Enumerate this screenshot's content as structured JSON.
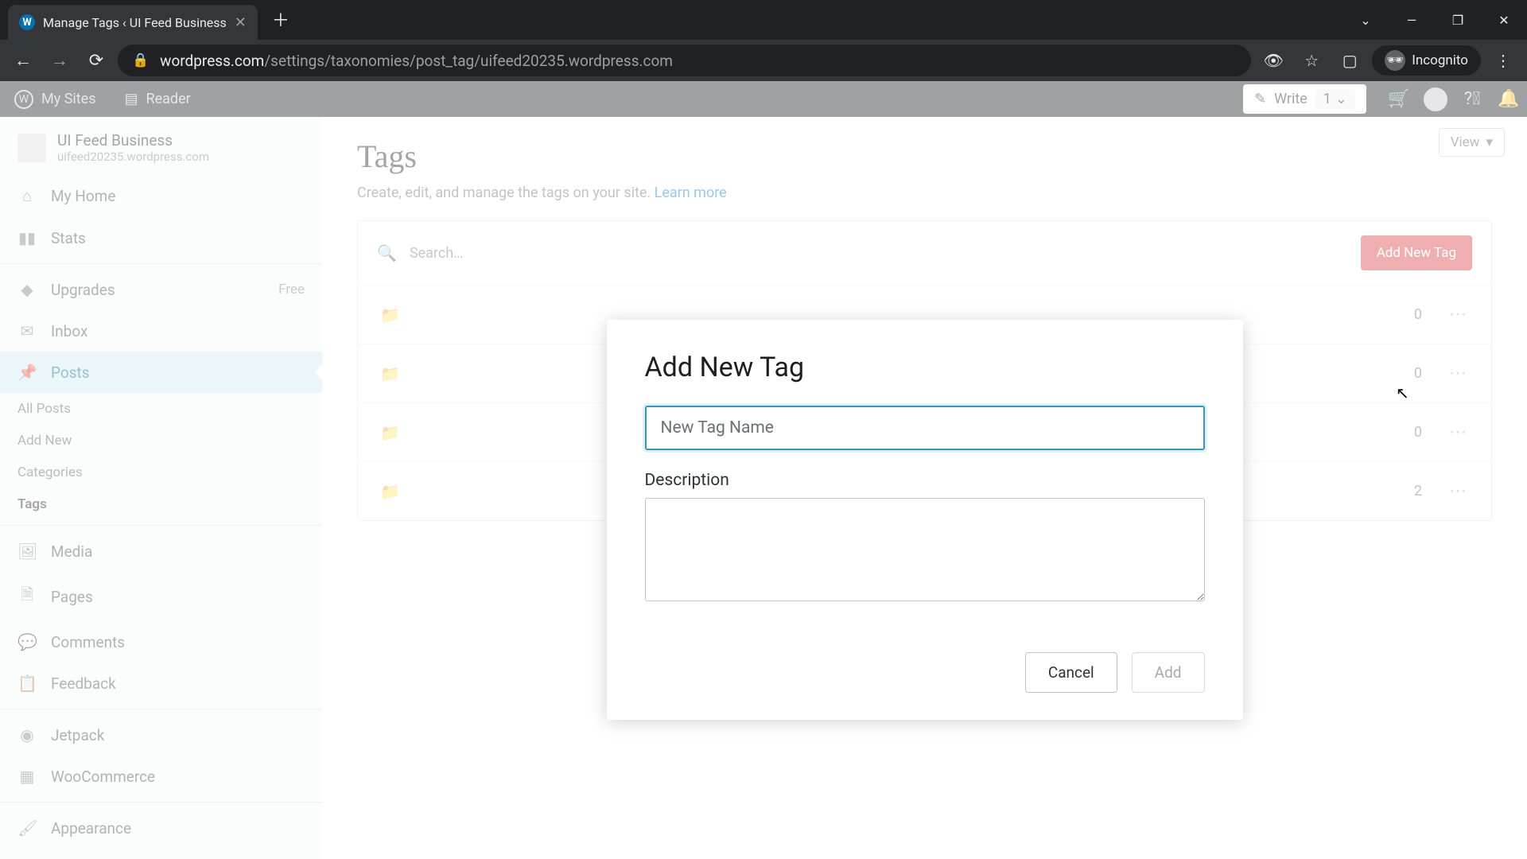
{
  "browser": {
    "tab_title": "Manage Tags ‹ UI Feed Business",
    "url_host": "wordpress.com",
    "url_path": "/settings/taxonomies/post_tag/uifeed20235.wordpress.com",
    "incognito_label": "Incognito"
  },
  "masterbar": {
    "my_sites": "My Sites",
    "reader": "Reader",
    "write": "Write",
    "write_count": "1"
  },
  "site": {
    "name": "UI Feed Business",
    "url": "uifeed20235.wordpress.com"
  },
  "sidebar": {
    "my_home": "My Home",
    "stats": "Stats",
    "upgrades": "Upgrades",
    "upgrades_badge": "Free",
    "inbox": "Inbox",
    "posts": "Posts",
    "all_posts": "All Posts",
    "add_new": "Add New",
    "categories": "Categories",
    "tags": "Tags",
    "media": "Media",
    "pages": "Pages",
    "comments": "Comments",
    "feedback": "Feedback",
    "jetpack": "Jetpack",
    "woocommerce": "WooCommerce",
    "appearance": "Appearance"
  },
  "main": {
    "view_label": "View",
    "title": "Tags",
    "subtitle_pre": "Create, edit, and manage the tags on your site. ",
    "subtitle_link": "Learn more",
    "search_placeholder": "Search…",
    "add_btn": "Add New Tag",
    "rows": [
      {
        "count": "0"
      },
      {
        "count": "0"
      },
      {
        "count": "0"
      },
      {
        "count": "2"
      }
    ]
  },
  "modal": {
    "title": "Add New Tag",
    "name_placeholder": "New Tag Name",
    "desc_label": "Description",
    "cancel": "Cancel",
    "add": "Add"
  }
}
